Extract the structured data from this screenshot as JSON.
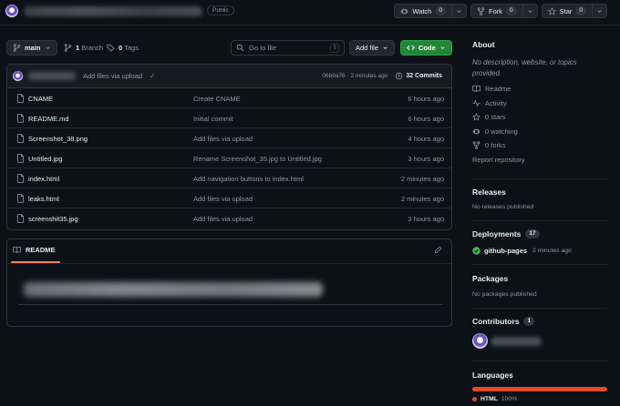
{
  "header": {
    "visibility": "Public",
    "actions": [
      {
        "icon": "eye-icon",
        "label": "Watch",
        "count": "0"
      },
      {
        "icon": "fork-icon",
        "label": "Fork",
        "count": "0"
      },
      {
        "icon": "star-icon",
        "label": "Star",
        "count": "0"
      }
    ]
  },
  "toolbar": {
    "branch": "main",
    "branch_count": "1",
    "branch_label": "Branch",
    "tags_count": "0",
    "tags_label": "Tags",
    "goto_placeholder": "Go to file",
    "goto_shortcut": "t",
    "add_file_label": "Add file",
    "code_label": "Code"
  },
  "commit": {
    "message": "Add files via upload",
    "check": "✓",
    "hash": "06b9a76",
    "separator": "·",
    "time": "2 minutes ago",
    "count_label": "32 Commits"
  },
  "files": [
    {
      "name": "CNAME",
      "commit": "Create CNAME",
      "age": "6 hours ago"
    },
    {
      "name": "README.md",
      "commit": "Initial commit",
      "age": "6 hours ago"
    },
    {
      "name": "Screenshot_38.png",
      "commit": "Add files via upload",
      "age": "4 hours ago"
    },
    {
      "name": "Untitled.jpg",
      "commit": "Rename Screenshot_35.jpg to Untitled.jpg",
      "age": "3 hours ago"
    },
    {
      "name": "index.html",
      "commit": "Add navigation buttons to index.html",
      "age": "2 minutes ago"
    },
    {
      "name": "leaks.html",
      "commit": "Add files via upload",
      "age": "2 minutes ago"
    },
    {
      "name": "screenshit35.jpg",
      "commit": "Add files via upload",
      "age": "3 hours ago"
    }
  ],
  "readme": {
    "tab_label": "README"
  },
  "about": {
    "title": "About",
    "description": "No description, website, or topics provided.",
    "items": [
      {
        "icon": "book-icon",
        "label": "Readme"
      },
      {
        "icon": "pulse-icon",
        "label": "Activity"
      },
      {
        "icon": "star-icon",
        "label": "0 stars"
      },
      {
        "icon": "eye-icon",
        "label": "0 watching"
      },
      {
        "icon": "fork-icon",
        "label": "0 forks"
      }
    ],
    "report_label": "Report repository"
  },
  "releases": {
    "title": "Releases",
    "empty": "No releases published"
  },
  "deployments": {
    "title": "Deployments",
    "count": "17",
    "env": "github-pages",
    "time": "2 minutes ago"
  },
  "packages": {
    "title": "Packages",
    "empty": "No packages published"
  },
  "contributors": {
    "title": "Contributors",
    "count": "1"
  },
  "languages": {
    "title": "Languages",
    "items": [
      {
        "name": "HTML",
        "percent": "100%",
        "color": "#e34c26"
      }
    ]
  },
  "colors": {
    "accent_green": "#238636",
    "success": "#3fb950",
    "html_lang": "#e34c26",
    "tab_underline": "#f78166"
  }
}
